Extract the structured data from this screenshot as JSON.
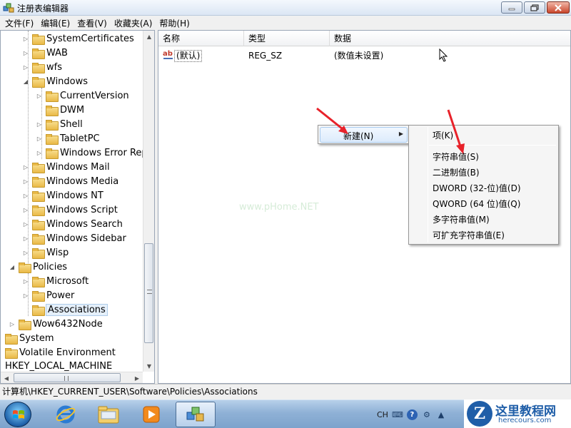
{
  "window": {
    "title": "注册表编辑器",
    "minimize_icon": "minimize-icon",
    "maximize_icon": "maximize-icon",
    "close_icon": "close-icon"
  },
  "menubar": {
    "items": [
      "文件(F)",
      "编辑(E)",
      "查看(V)",
      "收藏夹(A)",
      "帮助(H)"
    ]
  },
  "tree": {
    "items": [
      {
        "label": "SystemCertificates",
        "expander": "▷"
      },
      {
        "label": "WAB",
        "expander": "▷"
      },
      {
        "label": "wfs",
        "expander": "▷"
      },
      {
        "label": "Windows",
        "expander": "◢"
      },
      {
        "label": "CurrentVersion",
        "expander": "▷"
      },
      {
        "label": "DWM",
        "expander": ""
      },
      {
        "label": "Shell",
        "expander": "▷"
      },
      {
        "label": "TabletPC",
        "expander": "▷"
      },
      {
        "label": "Windows Error Rep",
        "expander": "▷"
      },
      {
        "label": "Windows Mail",
        "expander": "▷"
      },
      {
        "label": "Windows Media",
        "expander": "▷"
      },
      {
        "label": "Windows NT",
        "expander": "▷"
      },
      {
        "label": "Windows Script",
        "expander": "▷"
      },
      {
        "label": "Windows Search",
        "expander": "▷"
      },
      {
        "label": "Windows Sidebar",
        "expander": "▷"
      },
      {
        "label": "Wisp",
        "expander": "▷"
      },
      {
        "label": "Policies",
        "expander": "◢"
      },
      {
        "label": "Microsoft",
        "expander": "▷"
      },
      {
        "label": "Power",
        "expander": "▷"
      },
      {
        "label": "Associations",
        "expander": ""
      },
      {
        "label": "Wow6432Node",
        "expander": "▷"
      },
      {
        "label": "System",
        "expander": ""
      },
      {
        "label": "Volatile Environment",
        "expander": ""
      }
    ],
    "root_label": "HKEY_LOCAL_MACHINE",
    "selected": "Associations"
  },
  "list": {
    "columns": [
      "名称",
      "类型",
      "数据"
    ],
    "rows": [
      {
        "name": "(默认)",
        "type": "REG_SZ",
        "data": "(数值未设置)",
        "icon": "string-value-icon"
      }
    ]
  },
  "context_menu": {
    "item_label": "新建(N)",
    "submenu_icon": "chevron-right-icon"
  },
  "submenu": {
    "items": [
      "项(K)",
      "字符串值(S)",
      "二进制值(B)",
      "DWORD (32-位)值(D)",
      "QWORD (64 位)值(Q)",
      "多字符串值(M)",
      "可扩充字符串值(E)"
    ]
  },
  "statusbar": {
    "path": "计算机\\HKEY_CURRENT_USER\\Software\\Policies\\Associations"
  },
  "taskbar": {
    "tray_language": "CH",
    "apps": [
      "internet-explorer-icon",
      "windows-explorer-icon",
      "media-player-icon",
      "regedit-icon"
    ]
  },
  "watermark": {
    "text": "www.pHome.NET",
    "brand": "这里教程网",
    "url": "herecours.com",
    "logo_letter": "Z"
  },
  "colors": {
    "accent": "#1f5ea8",
    "annotation_arrow": "#e8222a",
    "selection": "#e5f0fb"
  }
}
